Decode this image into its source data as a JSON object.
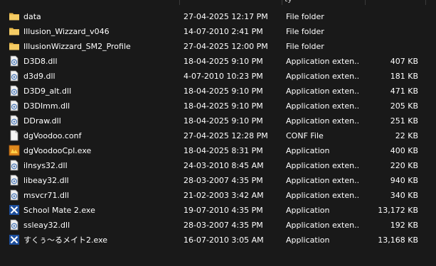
{
  "header": {
    "partial_label": "ty"
  },
  "files": [
    {
      "name": "data",
      "date": "27-04-2025 12:17 PM",
      "type": "File folder",
      "size": "",
      "icon": "folder"
    },
    {
      "name": "Illusion_Wizzard_v046",
      "date": "14-07-2010 2:41 PM",
      "type": "File folder",
      "size": "",
      "icon": "folder"
    },
    {
      "name": "IllusionWizzard_SM2_Profile",
      "date": "27-04-2025 12:00 PM",
      "type": "File folder",
      "size": "",
      "icon": "folder"
    },
    {
      "name": "D3D8.dll",
      "date": "18-04-2025 9:10 PM",
      "type": "Application exten...",
      "size": "407 KB",
      "icon": "dll"
    },
    {
      "name": "d3d9.dll",
      "date": "4-07-2010 10:23 PM",
      "type": "Application exten...",
      "size": "181 KB",
      "icon": "dll"
    },
    {
      "name": "D3D9_alt.dll",
      "date": "18-04-2025 9:10 PM",
      "type": "Application exten...",
      "size": "471 KB",
      "icon": "dll"
    },
    {
      "name": "D3DImm.dll",
      "date": "18-04-2025 9:10 PM",
      "type": "Application exten...",
      "size": "205 KB",
      "icon": "dll"
    },
    {
      "name": "DDraw.dll",
      "date": "18-04-2025 9:10 PM",
      "type": "Application exten...",
      "size": "251 KB",
      "icon": "dll"
    },
    {
      "name": "dgVoodoo.conf",
      "date": "27-04-2025 12:28 PM",
      "type": "CONF File",
      "size": "22 KB",
      "icon": "file"
    },
    {
      "name": "dgVoodooCpl.exe",
      "date": "18-04-2025 8:31 PM",
      "type": "Application",
      "size": "400 KB",
      "icon": "exe-orange"
    },
    {
      "name": "ilnsys32.dll",
      "date": "24-03-2010 8:45 AM",
      "type": "Application exten...",
      "size": "220 KB",
      "icon": "dll"
    },
    {
      "name": "libeay32.dll",
      "date": "28-03-2007 4:35 PM",
      "type": "Application exten...",
      "size": "940 KB",
      "icon": "dll"
    },
    {
      "name": "msvcr71.dll",
      "date": "21-02-2003 3:42 AM",
      "type": "Application exten...",
      "size": "340 KB",
      "icon": "dll"
    },
    {
      "name": "School Mate 2.exe",
      "date": "19-07-2010 4:35 PM",
      "type": "Application",
      "size": "13,172 KB",
      "icon": "exe-blue"
    },
    {
      "name": "ssleay32.dll",
      "date": "28-03-2007 4:35 PM",
      "type": "Application exten...",
      "size": "192 KB",
      "icon": "dll"
    },
    {
      "name": "すくぅ〜るメイト2.exe",
      "date": "16-07-2010 3:05 AM",
      "type": "Application",
      "size": "13,168 KB",
      "icon": "exe-blue"
    }
  ],
  "colors": {
    "background": "#191919",
    "text": "#ffffff",
    "folder": "#e8b84a",
    "exe_blue": "#1d4f9e",
    "exe_orange": "#e08a1e"
  }
}
